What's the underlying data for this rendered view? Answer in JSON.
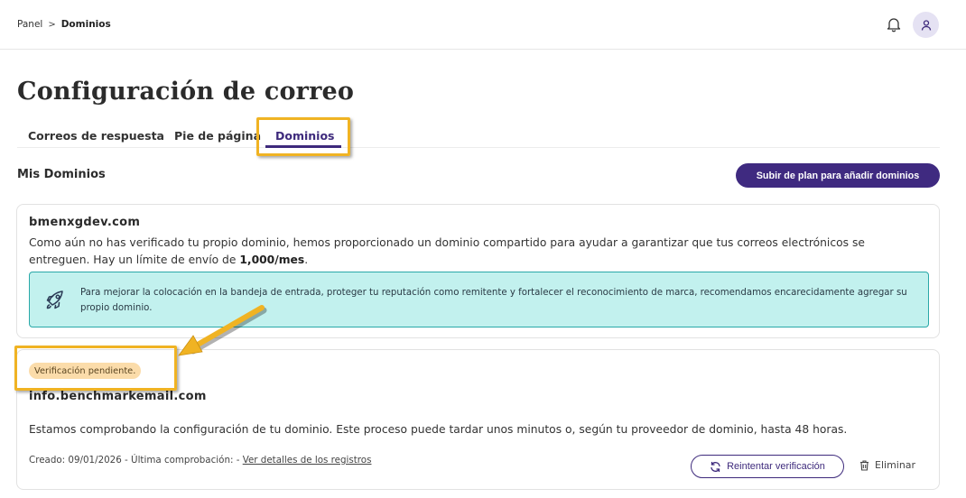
{
  "breadcrumb": {
    "root": "Panel",
    "separator": ">",
    "current": "Dominios"
  },
  "header": {
    "bell_icon": "bell-icon",
    "avatar_icon": "user-icon"
  },
  "page": {
    "title": "Configuración de correo"
  },
  "tabs": [
    {
      "label": "Correos de respuesta",
      "active": false
    },
    {
      "label": "Pie de página",
      "active": false
    },
    {
      "label": "Dominios",
      "active": true
    }
  ],
  "section": {
    "title": "Mis Dominios",
    "upgrade_label": "Subir de plan para añadir dominios"
  },
  "shared_domain": {
    "name": "bmenxgdev.com",
    "description_part1": "Como aún no has verificado tu propio dominio, hemos proporcionado un dominio compartido para ayudar a garantizar que tus correos electrónicos se entreguen. Hay un límite de envío de ",
    "limit": "1,000/mes",
    "description_part2": ".",
    "tip_icon": "rocket-icon",
    "tip": "Para mejorar la colocación en la bandeja de entrada, proteger tu reputación como remitente y fortalecer el reconocimiento de marca, recomendamos encarecidamente agregar su propio dominio."
  },
  "pending_domain": {
    "status": "Verificación pendiente.",
    "name": "info.benchmarkemail.com",
    "description": "Estamos comprobando la configuración de tu dominio. Este proceso puede tardar unos minutos o, según tu proveedor de dominio, hasta 48 horas.",
    "meta_text": "Creado: 09/01/2026 - Última comprobación: - ",
    "details_link": "Ver detalles de los registros",
    "retry_label": "Reintentar verificación",
    "delete_label": "Eliminar"
  },
  "colors": {
    "accent": "#3e2a7c",
    "highlight": "#f0b323",
    "tip_bg": "#c2f1ee",
    "badge_bg": "#fbdcaa"
  }
}
